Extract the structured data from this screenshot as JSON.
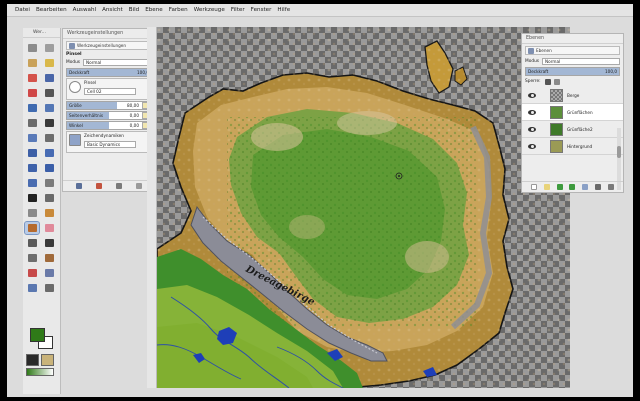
{
  "menubar": {
    "items": [
      "Datei",
      "Bearbeiten",
      "Auswahl",
      "Ansicht",
      "Bild",
      "Ebene",
      "Farben",
      "Werkzeuge",
      "Filter",
      "Fenster",
      "Hilfe"
    ]
  },
  "toolbox": {
    "title": "Wer...",
    "tools": [
      {
        "icon": "rect-select-icon",
        "color": "#8c8c8c"
      },
      {
        "icon": "ellipse-select-icon",
        "color": "#9e9e9e"
      },
      {
        "icon": "free-select-icon",
        "color": "#c9a25a"
      },
      {
        "icon": "fuzzy-select-icon",
        "color": "#d9b84a"
      },
      {
        "icon": "color-select-icon",
        "color": "#d4534b"
      },
      {
        "icon": "scissors-icon",
        "color": "#4a66a8"
      },
      {
        "icon": "foreground-select-icon",
        "color": "#d04848"
      },
      {
        "icon": "paths-icon",
        "color": "#555555"
      },
      {
        "icon": "color-picker-icon",
        "color": "#406bb0"
      },
      {
        "icon": "zoom-icon",
        "color": "#5477b5"
      },
      {
        "icon": "measure-icon",
        "color": "#6b6b6b"
      },
      {
        "icon": "move-icon",
        "color": "#3a3a3a"
      },
      {
        "icon": "align-icon",
        "color": "#5a7ab8"
      },
      {
        "icon": "crop-icon",
        "color": "#6d6d6d"
      },
      {
        "icon": "rotate-icon",
        "color": "#3d5fa6"
      },
      {
        "icon": "scale-icon",
        "color": "#476bb3"
      },
      {
        "icon": "shear-icon",
        "color": "#3f62aa"
      },
      {
        "icon": "perspective-icon",
        "color": "#3a5ea8"
      },
      {
        "icon": "flip-icon",
        "color": "#4a6cb0"
      },
      {
        "icon": "cage-icon",
        "color": "#7b7b7b"
      },
      {
        "icon": "text-icon",
        "color": "#222222"
      },
      {
        "icon": "bucket-fill-icon",
        "color": "#6a6a6a"
      },
      {
        "icon": "blend-icon",
        "color": "#8a8a8a"
      },
      {
        "icon": "pencil-icon",
        "color": "#c98a3a"
      },
      {
        "icon": "paintbrush-icon",
        "color": "#b56a2e"
      },
      {
        "icon": "eraser-icon",
        "color": "#e08a9a"
      },
      {
        "icon": "airbrush-icon",
        "color": "#5a5a5a"
      },
      {
        "icon": "ink-icon",
        "color": "#3a3a3a"
      },
      {
        "icon": "mypaint-brush-icon",
        "color": "#6e6e6e"
      },
      {
        "icon": "clone-icon",
        "color": "#a06a3a"
      },
      {
        "icon": "heal-icon",
        "color": "#c74a4a"
      },
      {
        "icon": "perspective-clone-icon",
        "color": "#6a7aa8"
      },
      {
        "icon": "smudge-icon",
        "color": "#5b78b0"
      },
      {
        "icon": "dodge-burn-icon",
        "color": "#6b6b6b"
      }
    ],
    "fg_color": "#2f7a18",
    "bg_color": "#ffffff"
  },
  "tool_options": {
    "dock_title": "Werkzeugeinstellungen",
    "tab_label": "Werkzeugeinstellungen",
    "tool_name": "Pinsel",
    "mode_label": "Modus",
    "mode_value": "Normal",
    "opacity_label": "Deckkraft",
    "opacity_value": "100,0",
    "opacity_fraction": 1.0,
    "brush_label": "Pinsel",
    "brush_value": "Cell 02",
    "size_label": "Größe",
    "size_value": "80,00",
    "ratio_label": "Seitenverhältnis",
    "ratio_value": "0,00",
    "angle_label": "Winkel",
    "angle_value": "0,00",
    "dynamics_label": "Zeichendynamiken",
    "dynamics_value": "Basic Dynamics"
  },
  "layers": {
    "dock_title": "Ebenen",
    "tab_label": "Ebenen",
    "mode_label": "Modus",
    "mode_value": "Normal",
    "opacity_label": "Deckkraft",
    "opacity_value": "100,0",
    "lock_label": "Sperre:",
    "items": [
      {
        "name": "Berge",
        "thumb": "checker"
      },
      {
        "name": "Grünflächen",
        "thumb": "#5c8f3a"
      },
      {
        "name": "Grünfläche2",
        "thumb": "#3f7a2a"
      },
      {
        "name": "Hintergrund",
        "thumb": "#9a9a55"
      }
    ]
  },
  "map": {
    "label": "Dreeagebirge"
  }
}
